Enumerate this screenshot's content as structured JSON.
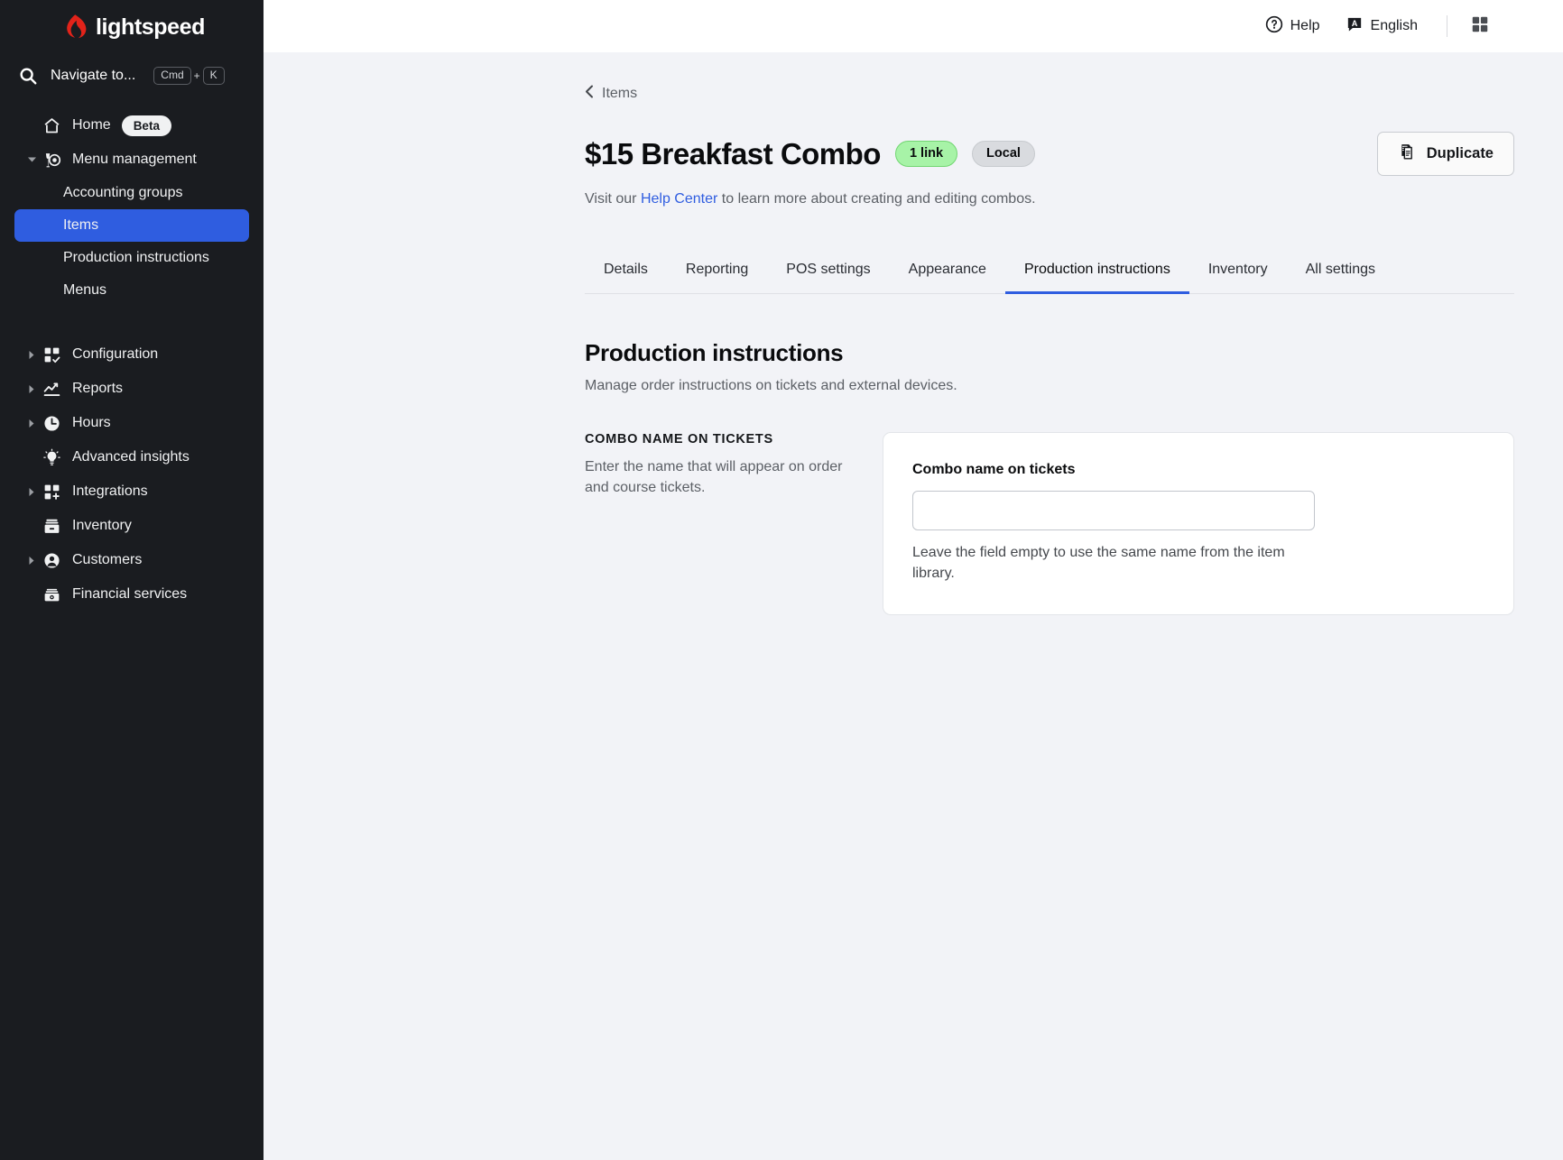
{
  "brand": {
    "name": "lightspeed",
    "logo_icon": "lightspeed-flame-logo"
  },
  "sidebar": {
    "search": {
      "label": "Navigate to...",
      "icon": "search-icon",
      "key_modifier": "Cmd",
      "key_plus": "+",
      "key_letter": "K"
    },
    "items": [
      {
        "label": "Home",
        "icon": "home-icon",
        "badge": "Beta",
        "type": "row"
      },
      {
        "label": "Menu management",
        "icon": "menu-management-icon",
        "type": "expandable",
        "expanded": true
      },
      {
        "label": "Accounting groups",
        "type": "sub"
      },
      {
        "label": "Items",
        "type": "sub",
        "active": true
      },
      {
        "label": "Production instructions",
        "type": "sub"
      },
      {
        "label": "Menus",
        "type": "sub"
      },
      {
        "label": "Configuration",
        "icon": "configuration-icon",
        "type": "expandable"
      },
      {
        "label": "Reports",
        "icon": "reports-icon",
        "type": "expandable"
      },
      {
        "label": "Hours",
        "icon": "hours-icon",
        "type": "expandable"
      },
      {
        "label": "Advanced insights",
        "icon": "lightbulb-icon",
        "type": "row"
      },
      {
        "label": "Integrations",
        "icon": "integrations-icon",
        "type": "expandable"
      },
      {
        "label": "Inventory",
        "icon": "inventory-box-icon",
        "type": "row"
      },
      {
        "label": "Customers",
        "icon": "customers-icon",
        "type": "expandable"
      },
      {
        "label": "Financial services",
        "icon": "money-icon",
        "type": "row"
      }
    ]
  },
  "topbar": {
    "help_label": "Help",
    "help_icon": "help-circle-icon",
    "language_label": "English",
    "language_icon": "translate-icon",
    "grid_icon": "apps-grid-icon"
  },
  "page": {
    "breadcrumb": {
      "label": "Items",
      "icon": "chevron-left-icon"
    },
    "title": "$15 Breakfast Combo",
    "chips": [
      {
        "label": "1 link",
        "style": "green"
      },
      {
        "label": "Local",
        "style": "gray"
      }
    ],
    "duplicate_button": {
      "label": "Duplicate",
      "icon": "duplicate-icon"
    },
    "subtitle_pre": "Visit our ",
    "subtitle_link": "Help Center",
    "subtitle_post": " to learn more about creating and editing combos."
  },
  "tabs": [
    {
      "label": "Details",
      "active": false
    },
    {
      "label": "Reporting",
      "active": false
    },
    {
      "label": "POS settings",
      "active": false
    },
    {
      "label": "Appearance",
      "active": false
    },
    {
      "label": "Production instructions",
      "active": true
    },
    {
      "label": "Inventory",
      "active": false
    },
    {
      "label": "All settings",
      "active": false
    }
  ],
  "section": {
    "title": "Production instructions",
    "subtitle": "Manage order instructions on tickets and external devices."
  },
  "field": {
    "desc_title": "COMBO NAME ON TICKETS",
    "desc_text": "Enter the name that will appear on order and course tickets.",
    "card_label": "Combo name on tickets",
    "input_value": "",
    "input_placeholder": "",
    "help_text": "Leave the field empty to use the same name from the item library."
  },
  "colors": {
    "sidebar_bg": "#1a1c20",
    "accent_blue": "#2f5de0",
    "content_bg": "#f2f3f7",
    "chip_green_bg": "#a7f3a7",
    "chip_gray_bg": "#d9dbdf",
    "brand_red": "#e2231a"
  }
}
